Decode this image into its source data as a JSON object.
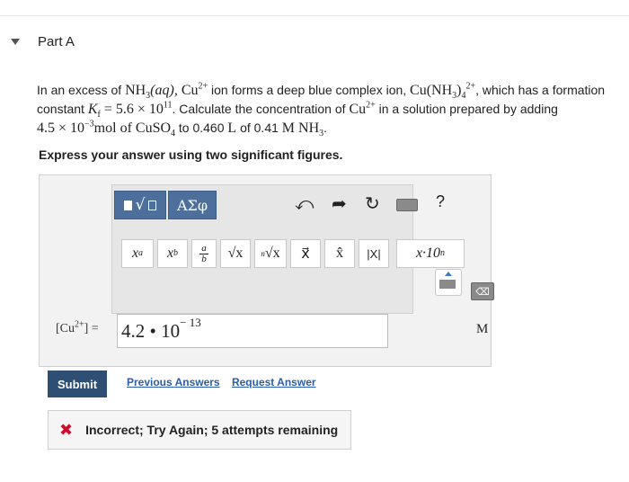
{
  "part": {
    "title": "Part A"
  },
  "problem": {
    "t1": "In an excess of ",
    "nh3aq": "NH",
    "nh3aq_sub": "3",
    "nh3aq_tail": "(aq), ",
    "cu": "Cu",
    "cu_sup": "2+",
    "t2": " ion forms a deep blue complex ion, ",
    "cx": "Cu(NH",
    "cx_sub3": "3",
    "cx_close": ")",
    "cx_sub4": "4",
    "cx_sup": "2+",
    "t3": ", which has a formation",
    "t4": "constant ",
    "kf": "K",
    "kf_sub": "f",
    "kf_val": " = 5.6 × 10",
    "kf_exp": "11",
    "t5": ". Calculate the concentration of ",
    "cu2": "Cu",
    "cu2_sup": "2+",
    "t6": " in a solution prepared by adding",
    "amt": "4.5 × 10",
    "amt_exp": "−3",
    "amt_unit": "mol of CuSO",
    "amt_sub": "4",
    "t7": " to 0.460 ",
    "L": "L",
    "t8": " of 0.41 ",
    "M": "M NH",
    "M_sub": "3",
    "t9": "."
  },
  "instruction": "Express your answer using two significant figures.",
  "toolbar": {
    "greek_label": "ΑΣφ",
    "undo_glyph": "⤺",
    "redo_glyph": "➦",
    "reset_glyph": "↻",
    "help_label": "?",
    "symbols": {
      "sup_base": "x",
      "sup_exp": "a",
      "sub_base": "x",
      "sub_idx": "b",
      "frac_num": "a",
      "frac_den": "b",
      "sqrt": "√x",
      "nroot_idx": "n",
      "nroot": "√x",
      "vec": "x⃗",
      "hat": "x̂",
      "abs": "|X|",
      "sci": "x·10",
      "sci_exp": "n"
    },
    "delete_label": "⌫"
  },
  "answer": {
    "lhs_open": "[Cu",
    "lhs_sup": "2+",
    "lhs_close": "] =",
    "value_mantissa": "4.2 • 10",
    "value_exp": "− 13",
    "unit": "M"
  },
  "actions": {
    "submit": "Submit",
    "previous": "Previous Answers",
    "request": "Request Answer"
  },
  "feedback": {
    "icon": "✖",
    "message": "Incorrect; Try Again; 5 attempts remaining"
  }
}
